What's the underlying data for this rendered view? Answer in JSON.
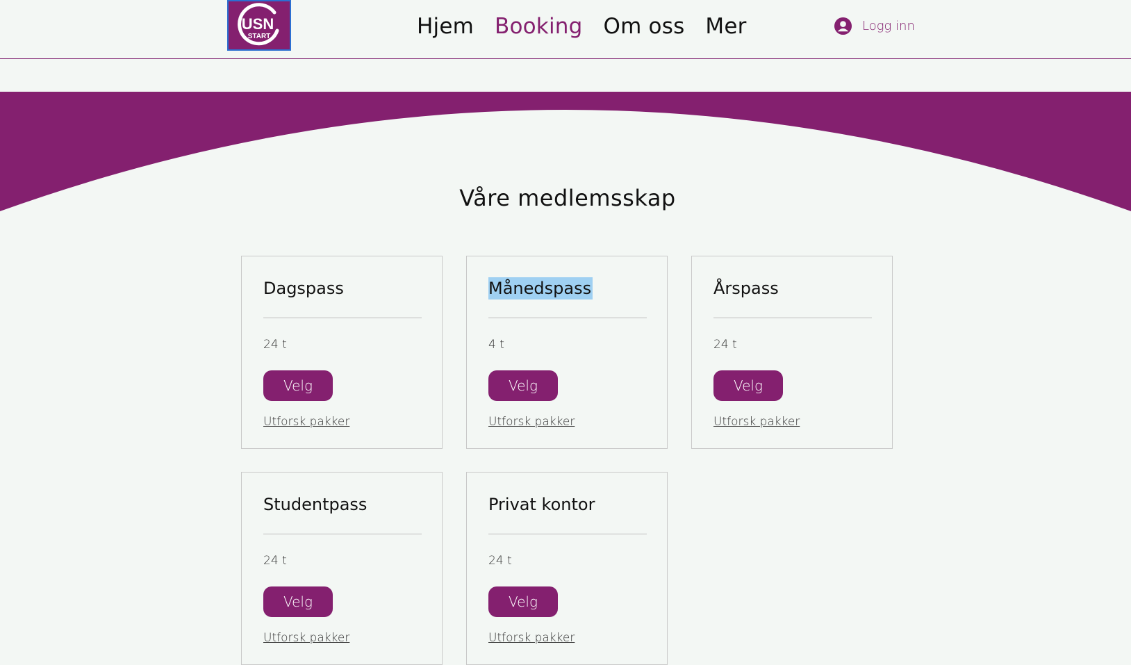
{
  "brand": {
    "logo_text_main": "USN",
    "logo_text_sub": "START",
    "color": "#84206f"
  },
  "nav": {
    "items": [
      {
        "label": "Hjem",
        "active": false
      },
      {
        "label": "Booking",
        "active": true
      },
      {
        "label": "Om oss",
        "active": false
      },
      {
        "label": "Mer",
        "active": false
      }
    ]
  },
  "login": {
    "label": "Logg inn",
    "icon": "user-avatar-icon"
  },
  "page_title": "Våre medlemsskap",
  "cards": [
    {
      "name": "Dagspass",
      "duration": "24 t",
      "button": "Velg",
      "link": "Utforsk pakker",
      "selected": false
    },
    {
      "name": "Månedspass",
      "duration": "4 t",
      "button": "Velg",
      "link": "Utforsk pakker",
      "selected": true
    },
    {
      "name": "Årspass",
      "duration": "24 t",
      "button": "Velg",
      "link": "Utforsk pakker",
      "selected": false
    },
    {
      "name": "Studentpass",
      "duration": "24 t",
      "button": "Velg",
      "link": "Utforsk pakker",
      "selected": false
    },
    {
      "name": "Privat kontor",
      "duration": "24 t",
      "button": "Velg",
      "link": "Utforsk pakker",
      "selected": false
    }
  ]
}
